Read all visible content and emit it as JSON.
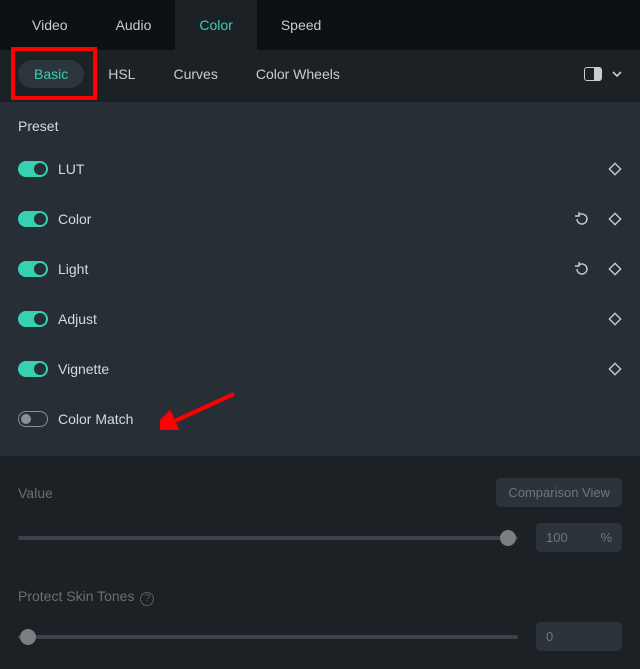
{
  "top_tabs": {
    "video": "Video",
    "audio": "Audio",
    "color": "Color",
    "speed": "Speed"
  },
  "sub_tabs": {
    "basic": "Basic",
    "hsl": "HSL",
    "curves": "Curves",
    "wheels": "Color Wheels"
  },
  "preset": "Preset",
  "rows": {
    "lut": "LUT",
    "color": "Color",
    "light": "Light",
    "adjust": "Adjust",
    "vignette": "Vignette",
    "colormatch": "Color Match"
  },
  "lower": {
    "value_label": "Value",
    "comparison": "Comparison View",
    "value_num": "100",
    "value_unit": "%",
    "protect": "Protect Skin Tones",
    "protect_num": "0"
  }
}
